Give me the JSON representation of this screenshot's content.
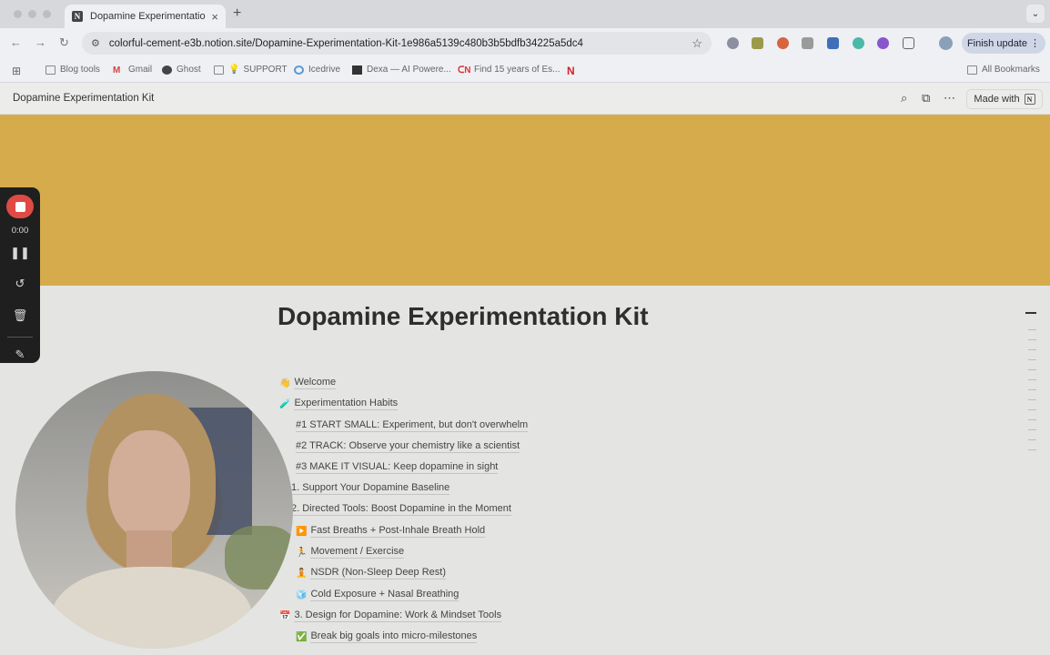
{
  "browser": {
    "tab_title": "Dopamine Experimentation Kit",
    "tab_favicon": "N",
    "url": "colorful-cement-e3b.notion.site/Dopamine-Experimentation-Kit-1e986a5139c480b3b5bdfb34225a5dc4",
    "finish_update": "Finish update",
    "all_bookmarks": "All Bookmarks",
    "bookmarks": [
      "Blog tools",
      "Gmail",
      "Ghost",
      "SUPPORT",
      "Icedrive",
      "Dexa — AI Powere...",
      "Find 15 years of Es...",
      "N"
    ]
  },
  "notion": {
    "breadcrumb": "Dopamine Experimentation Kit",
    "made_with": "Made with",
    "made_with_logo": "N",
    "cover_color": "#d6ab4c",
    "page_title": "Dopamine Experimentation Kit"
  },
  "recorder": {
    "time": "0:00"
  },
  "toc": [
    {
      "icon": "👋",
      "label": "Welcome"
    },
    {
      "icon": "🧪",
      "label": "Experimentation Habits"
    },
    {
      "icon": "",
      "label": "#1 START SMALL: Experiment, but don't overwhelm"
    },
    {
      "icon": "",
      "label": "#2 TRACK: Observe your chemistry like a scientist"
    },
    {
      "icon": "",
      "label": "#3 MAKE IT VISUAL: Keep dopamine in sight"
    },
    {
      "icon": "",
      "label": "1. Support Your Dopamine Baseline"
    },
    {
      "icon": "",
      "label": "2. Directed Tools: Boost Dopamine in the Moment"
    },
    {
      "icon": "▶️",
      "label": "Fast Breaths + Post-Inhale Breath Hold"
    },
    {
      "icon": "🏃",
      "label": "Movement / Exercise"
    },
    {
      "icon": "🧘",
      "label": "NSDR (Non-Sleep Deep Rest)"
    },
    {
      "icon": "🧊",
      "label": "Cold Exposure + Nasal Breathing"
    },
    {
      "icon": "📅",
      "label": "3. Design for Dopamine: Work & Mindset Tools"
    },
    {
      "icon": "✅",
      "label": "Break big goals into micro-milestones"
    }
  ]
}
